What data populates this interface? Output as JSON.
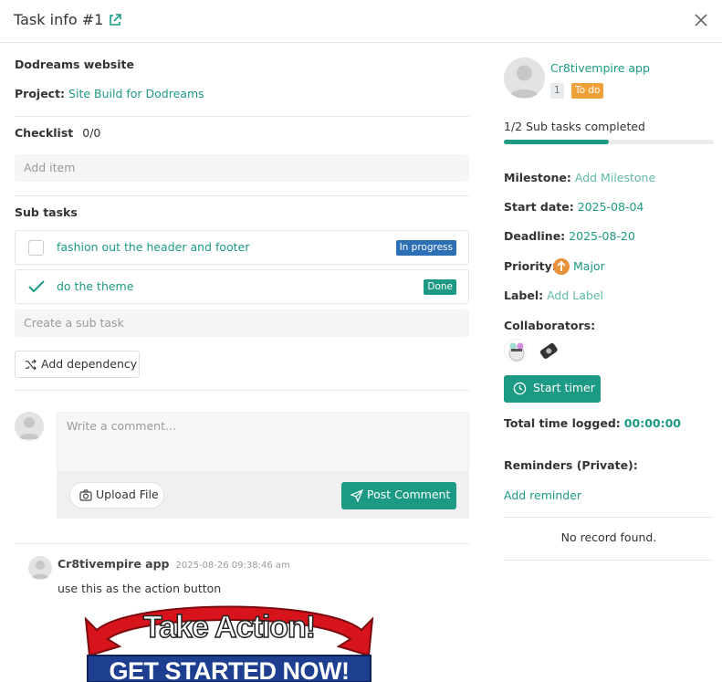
{
  "header": {
    "title": "Task info #1"
  },
  "task": {
    "name": "Dodreams website",
    "project_label": "Project:",
    "project_value": "Site Build for Dodreams"
  },
  "checklist": {
    "label": "Checklist",
    "count": "0/0",
    "add_placeholder": "Add item"
  },
  "subtasks": {
    "label": "Sub tasks",
    "items": [
      {
        "text": "fashion out the header and footer",
        "status": "In progress",
        "status_color": "#2d6fb5",
        "done": false
      },
      {
        "text": "do the theme",
        "status": "Done",
        "status_color": "#1c9a84",
        "done": true
      }
    ],
    "create_placeholder": "Create a sub task",
    "add_dependency": "Add dependency"
  },
  "comment": {
    "placeholder": "Write a comment...",
    "upload_label": "Upload File",
    "post_label": "Post Comment"
  },
  "comments": [
    {
      "author": "Cr8tivempire app",
      "time": "2025-08-26 09:38:46 am",
      "text": "use this as the action button",
      "image_line1": "Take Action!",
      "image_line2": "GET STARTED NOW!"
    }
  ],
  "sidebar": {
    "assignee": "Cr8tivempire app",
    "assignee_badge": "1",
    "status_badge": "To do",
    "subtask_progress_text": "1/2 Sub tasks completed",
    "subtask_progress": 0.5,
    "milestone_label": "Milestone:",
    "milestone_value": "Add Milestone",
    "start_label": "Start date:",
    "start_value": "2025-08-04",
    "deadline_label": "Deadline:",
    "deadline_value": "2025-08-20",
    "priority_label": "Priority:",
    "priority_value": "Major",
    "label_label": "Label:",
    "label_value": "Add Label",
    "collaborators_label": "Collaborators:",
    "timer_label": "Start timer",
    "time_logged_label": "Total time logged:",
    "time_logged_value": "00:00:00",
    "reminders_label": "Reminders (Private):",
    "add_reminder": "Add reminder",
    "no_record": "No record found."
  },
  "colors": {
    "accent": "#1c9a84",
    "todo": "#f0a038",
    "in_progress": "#2d6fb5",
    "priority": "#e8913a"
  }
}
